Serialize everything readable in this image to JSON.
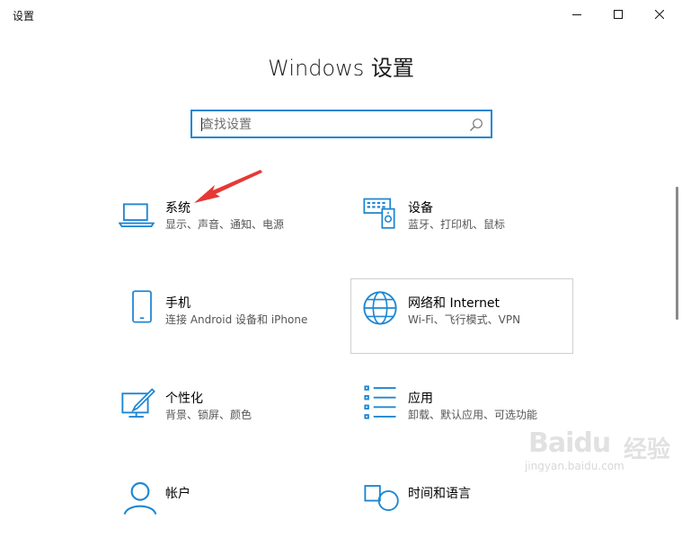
{
  "window": {
    "title": "设置",
    "controls": {
      "minimize_icon": "minimize-icon",
      "maximize_icon": "maximize-icon",
      "close_icon": "close-icon"
    }
  },
  "header": {
    "title": "Windows 设置"
  },
  "search": {
    "placeholder": "查找设置",
    "value": ""
  },
  "tiles": [
    {
      "name": "系统",
      "desc": "显示、声音、通知、电源",
      "icon": "laptop-icon"
    },
    {
      "name": "设备",
      "desc": "蓝牙、打印机、鼠标",
      "icon": "devices-icon"
    },
    {
      "name": "手机",
      "desc": "连接 Android 设备和 iPhone",
      "icon": "phone-icon"
    },
    {
      "name": "网络和 Internet",
      "desc": "Wi-Fi、飞行模式、VPN",
      "icon": "globe-icon"
    },
    {
      "name": "个性化",
      "desc": "背景、锁屏、颜色",
      "icon": "personalization-icon"
    },
    {
      "name": "应用",
      "desc": "卸载、默认应用、可选功能",
      "icon": "apps-icon"
    },
    {
      "name": "帐户",
      "desc": "",
      "icon": "account-icon"
    },
    {
      "name": "时间和语言",
      "desc": "",
      "icon": "time-language-icon"
    }
  ],
  "accent_color": "#1e87d3",
  "annotation": {
    "arrow_color": "#e53935"
  },
  "watermark": {
    "brand": "Baidu",
    "brand_cn": "经验",
    "url": "jingyan.baidu.com"
  }
}
